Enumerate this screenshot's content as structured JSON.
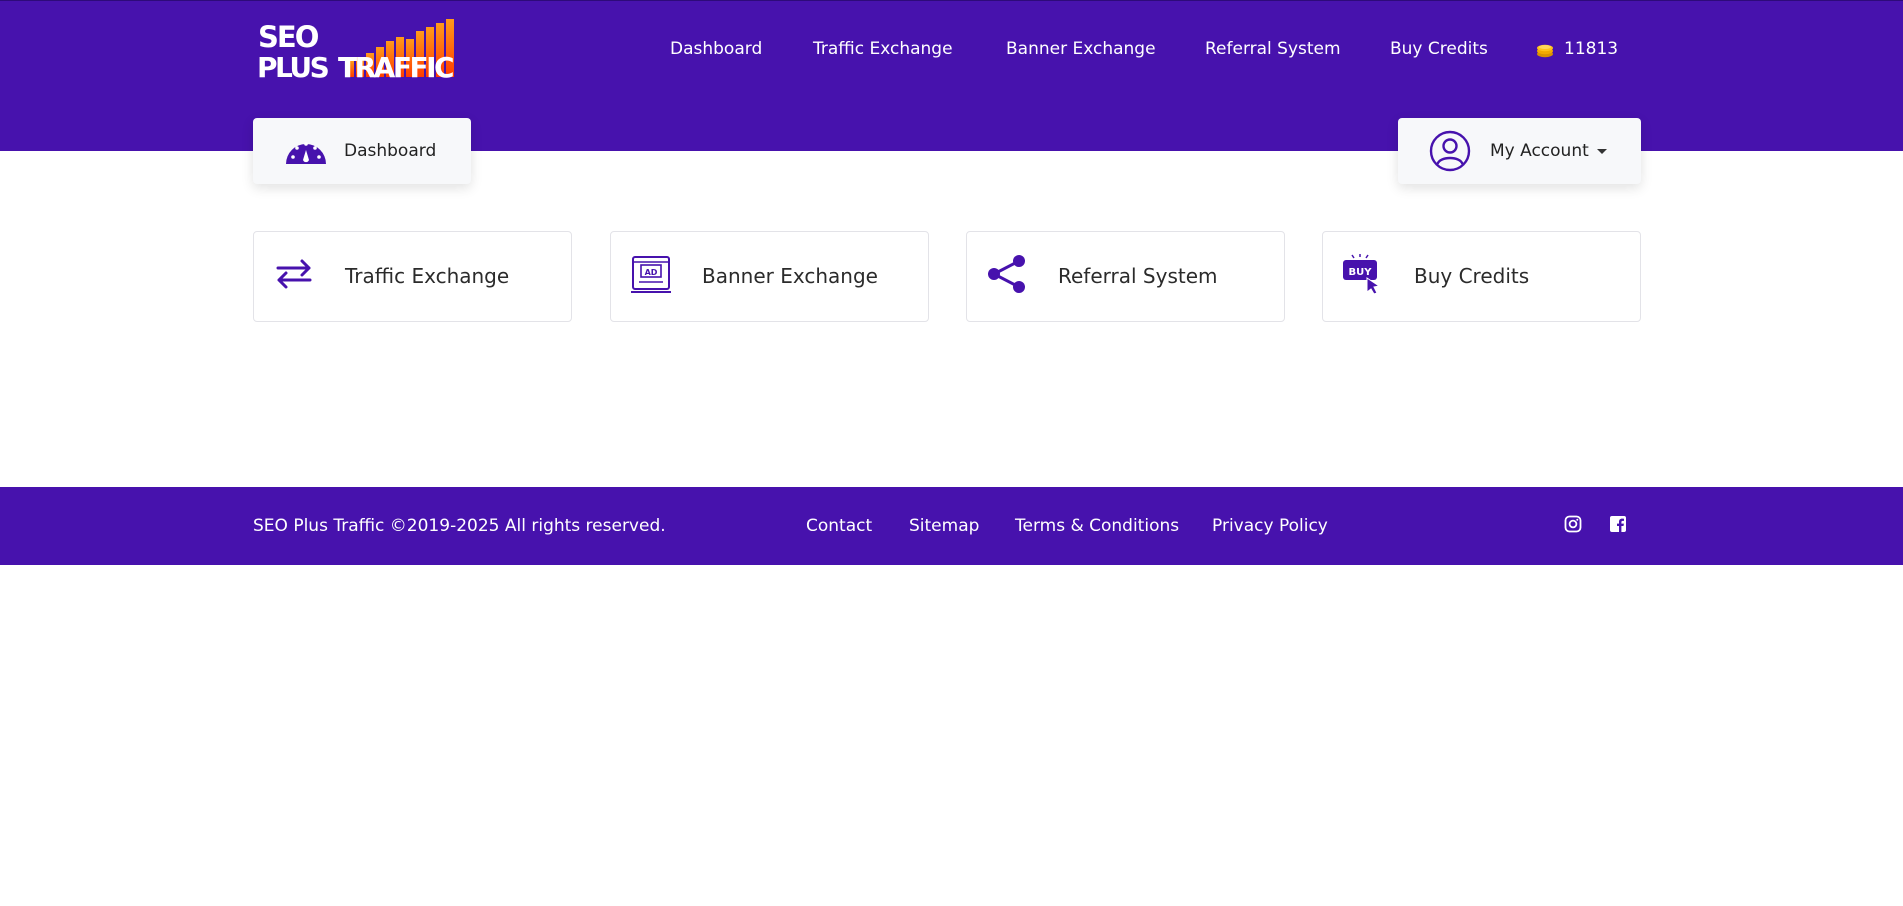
{
  "brand": {
    "logo_line1": "SEO",
    "logo_line2a": "PLUS",
    "logo_line2b": "TRAFFIC"
  },
  "topnav": {
    "items": [
      "Dashboard",
      "Traffic Exchange",
      "Banner Exchange",
      "Referral System",
      "Buy Credits"
    ],
    "credits": "11813"
  },
  "subnav": {
    "dashboard_label": "Dashboard",
    "account_label": "My Account"
  },
  "tiles": [
    {
      "label": "Traffic Exchange",
      "icon": "arrows-exchange-icon"
    },
    {
      "label": "Banner Exchange",
      "icon": "ad-banner-icon"
    },
    {
      "label": "Referral System",
      "icon": "share-icon"
    },
    {
      "label": "Buy Credits",
      "icon": "buy-cursor-icon"
    }
  ],
  "footer": {
    "copyright": "SEO Plus Traffic ©2019-2025 All rights reserved.",
    "links": [
      "Contact",
      "Sitemap",
      "Terms & Conditions",
      "Privacy Policy"
    ]
  },
  "colors": {
    "brand": "#4712ad",
    "accent_orange": "#ff6a1a",
    "coin": "#f5b50a"
  }
}
